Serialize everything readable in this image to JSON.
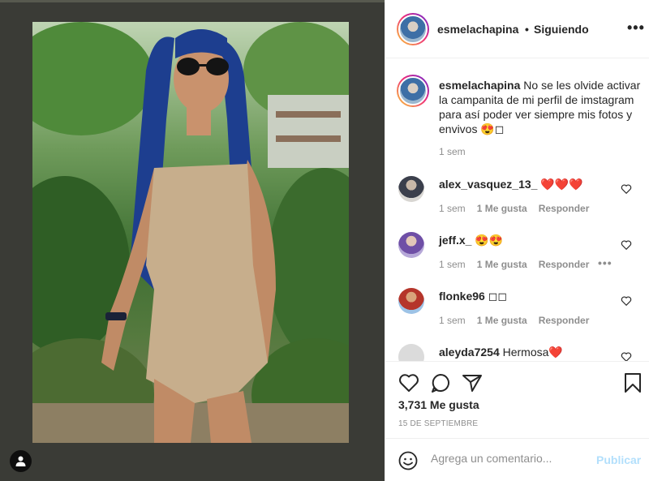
{
  "post": {
    "image_alt_icon": "user-photo",
    "header": {
      "username": "esmelachapina",
      "separator": "•",
      "follow_status": "Siguiendo",
      "more_icon": "more-horizontal-icon"
    },
    "caption": {
      "username": "esmelachapina",
      "text": " No se les olvide activar la campanita de mi perfil de imstagram para así poder ver siempre mis fotos y envivos 😍◻",
      "time": "1 sem"
    },
    "comments": [
      {
        "username": "alex_vasquez_13_",
        "text": " ❤️❤️❤️",
        "time": "1 sem",
        "likes": "1 Me gusta",
        "reply": "Responder"
      },
      {
        "username": "jeff.x_",
        "text": " 😍😍",
        "time": "1 sem",
        "likes": "1 Me gusta",
        "reply": "Responder",
        "more": "•••"
      },
      {
        "username": "flonke96",
        "text": " ◻◻",
        "time": "1 sem",
        "likes": "1 Me gusta",
        "reply": "Responder"
      },
      {
        "username": "aleyda7254",
        "text": " Hermosa❤️"
      }
    ],
    "likes_count": "3,731 Me gusta",
    "date": "15 DE SEPTIEMBRE",
    "add_comment": {
      "placeholder": "Agrega un comentario...",
      "publish_label": "Publicar"
    }
  }
}
